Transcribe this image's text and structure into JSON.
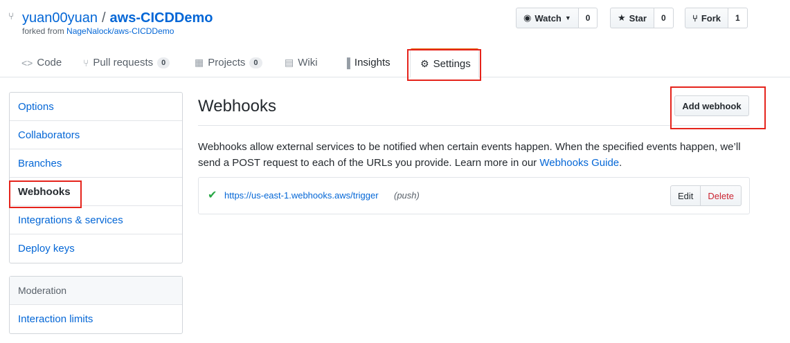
{
  "repo": {
    "owner": "yuan00yuan",
    "separator": "/",
    "name": "aws-CICDDemo",
    "forked_prefix": "forked from",
    "forked_from": "NageNalock/aws-CICDDemo"
  },
  "actions": {
    "watch": {
      "label": "Watch",
      "count": "0"
    },
    "star": {
      "label": "Star",
      "count": "0"
    },
    "fork": {
      "label": "Fork",
      "count": "1"
    }
  },
  "tabs": [
    {
      "label": "Code"
    },
    {
      "label": "Pull requests",
      "count": "0"
    },
    {
      "label": "Projects",
      "count": "0"
    },
    {
      "label": "Wiki"
    },
    {
      "label": "Insights"
    },
    {
      "label": "Settings",
      "selected": true
    }
  ],
  "sidebar": {
    "items": [
      {
        "label": "Options"
      },
      {
        "label": "Collaborators"
      },
      {
        "label": "Branches"
      },
      {
        "label": "Webhooks",
        "active": true
      },
      {
        "label": "Integrations & services"
      },
      {
        "label": "Deploy keys"
      }
    ],
    "moderation": {
      "heading": "Moderation",
      "items": [
        {
          "label": "Interaction limits"
        }
      ]
    }
  },
  "main": {
    "title": "Webhooks",
    "add_button": "Add webhook",
    "description_before": "Webhooks allow external services to be notified when certain events happen. When the specified events happen, we’ll send a POST request to each of the URLs you provide. Learn more in our ",
    "description_link": "Webhooks Guide",
    "description_after": ".",
    "webhook": {
      "url": "https://us-east-1.webhooks.aws/trigger",
      "event": "(push)",
      "edit_label": "Edit",
      "delete_label": "Delete"
    }
  },
  "colors": {
    "link": "#0366d6",
    "highlight": "#e5231b",
    "success": "#28a745",
    "danger": "#cb2431",
    "selected_tab_border": "#e36209"
  }
}
